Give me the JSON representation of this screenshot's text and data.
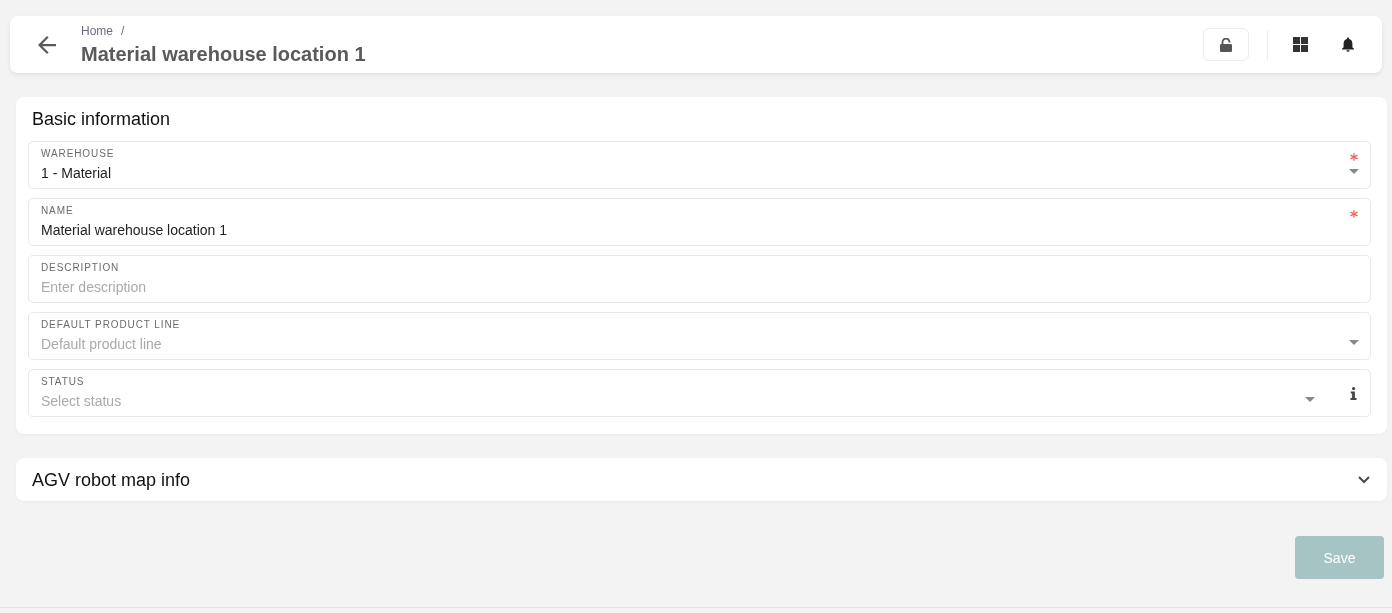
{
  "header": {
    "breadcrumb": [
      {
        "label": "Home",
        "separator": "/"
      }
    ],
    "title": "Material warehouse location 1",
    "lock_button": {
      "locked": false
    }
  },
  "basic_information": {
    "title": "Basic information",
    "fields": [
      {
        "kind": "select",
        "label": "WAREHOUSE",
        "value": "1 - Material",
        "required": true,
        "info": false
      },
      {
        "kind": "text",
        "label": "NAME",
        "value": "Material warehouse location 1",
        "required": true,
        "info": false
      },
      {
        "kind": "text",
        "label": "DESCRIPTION",
        "placeholder": "Enter description",
        "required": false,
        "info": false
      },
      {
        "kind": "select",
        "label": "DEFAULT PRODUCT LINE",
        "placeholder": "Default product line",
        "required": false,
        "info": false
      },
      {
        "kind": "select",
        "label": "STATUS",
        "placeholder": "Select status",
        "required": false,
        "info": true
      }
    ]
  },
  "agv_section": {
    "title": "AGV robot map info",
    "expanded": false
  },
  "save_button": {
    "label": "Save",
    "disabled": true
  }
}
